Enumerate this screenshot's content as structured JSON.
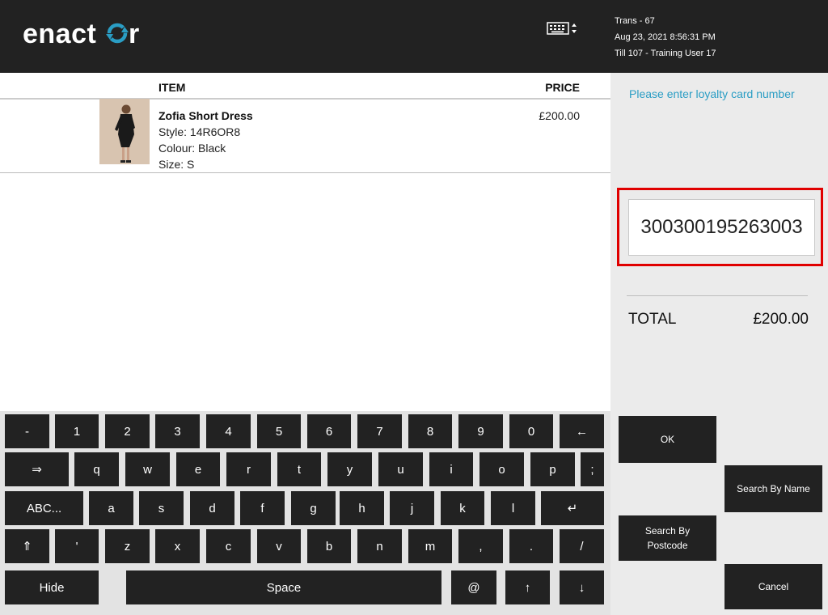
{
  "header": {
    "brand": "enactor",
    "trans": "Trans - 67",
    "datetime": "Aug 23, 2021 8:56:31 PM",
    "till": "Till 107 - Training User 17",
    "keyboard_icon": "keyboard-toggle-icon"
  },
  "list": {
    "col_item": "ITEM",
    "col_price": "PRICE",
    "items": [
      {
        "name": "Zofia Short Dress",
        "style": "Style: 14R6OR8",
        "colour": "Colour: Black",
        "size": "Size: S",
        "price": "£200.00"
      }
    ]
  },
  "side": {
    "prompt": "Please enter loyalty card number",
    "card_value": "300300195263003",
    "total_label": "TOTAL",
    "total_value": "£200.00",
    "buttons": {
      "ok": "OK",
      "search_by_name": "Search By Name",
      "search_by_postcode": "Search By Postcode",
      "cancel": "Cancel"
    }
  },
  "keyboard": {
    "row1": [
      "-",
      "1",
      "2",
      "3",
      "4",
      "5",
      "6",
      "7",
      "8",
      "9",
      "0",
      "←"
    ],
    "row2": [
      "⇒",
      "q",
      "w",
      "e",
      "r",
      "t",
      "y",
      "u",
      "i",
      "o",
      "p",
      ";"
    ],
    "row3": [
      "ABC...",
      "a",
      "s",
      "d",
      "f",
      "g",
      "h",
      "j",
      "k",
      "l",
      "↵"
    ],
    "row4": [
      "⇑",
      "'",
      "z",
      "x",
      "c",
      "v",
      "b",
      "n",
      "m",
      ",",
      ".",
      "/"
    ],
    "row5": [
      "Hide",
      "Space",
      "@",
      "↑",
      "↓"
    ]
  },
  "colors": {
    "header_bg": "#222222",
    "accent_blue": "#2a9dc4",
    "highlight_red": "#e00000",
    "key_bg": "#222222",
    "panel_bg": "#ebebeb"
  }
}
